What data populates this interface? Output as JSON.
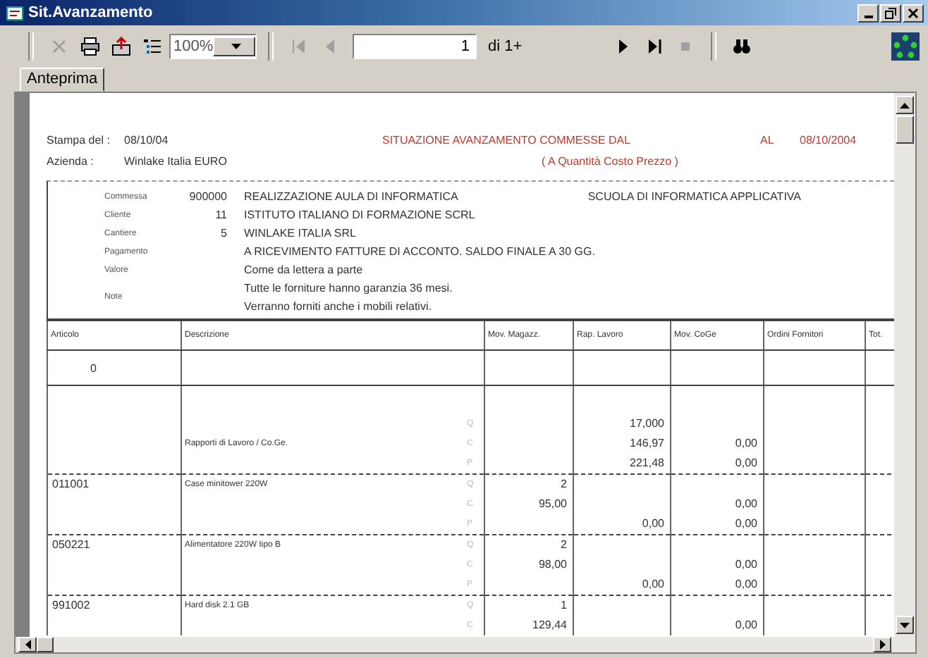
{
  "window": {
    "title": "Sit.Avanzamento"
  },
  "toolbar": {
    "buttons": [
      {
        "kind": "close",
        "disabled": true
      },
      {
        "kind": "print",
        "disabled": false
      },
      {
        "kind": "export",
        "disabled": false
      },
      {
        "kind": "tree",
        "disabled": false
      }
    ],
    "zoom": "100%",
    "nav": [
      {
        "kind": "first",
        "disabled": true
      },
      {
        "kind": "prev",
        "disabled": true
      }
    ],
    "page": "1",
    "page_count": "di 1+",
    "nav2": [
      {
        "kind": "next",
        "disabled": false
      },
      {
        "kind": "last",
        "disabled": false
      },
      {
        "kind": "stop",
        "disabled": true
      },
      {
        "kind": "find",
        "disabled": false
      }
    ]
  },
  "tabs": [
    {
      "label": "Anteprima",
      "selected": true
    }
  ],
  "report": {
    "print_date_label": "Stampa del :",
    "print_date": "08/10/04",
    "company_label": "Azienda :",
    "company": "Winlake Italia EURO",
    "title": "SITUAZIONE AVANZAMENTO COMMESSE  DAL",
    "to_label": "AL",
    "to_date": "08/10/2004",
    "subtitle": "( A Quantità Costo Prezzo  )",
    "fields": [
      {
        "label": "Commessa",
        "code": "900000",
        "lines": [
          "REALIZZAZIONE AULA DI INFORMATICA"
        ],
        "extra": "SCUOLA DI INFORMATICA APPLICATIVA"
      },
      {
        "label": "Cliente",
        "code": "11",
        "lines": [
          "ISTITUTO ITALIANO DI FORMAZIONE SCRL"
        ]
      },
      {
        "label": "Cantiere",
        "code": "5",
        "lines": [
          "WINLAKE ITALIA SRL"
        ]
      },
      {
        "label": "Pagamento",
        "lines": [
          "A RICEVIMENTO FATTURE DI ACCONTO. SALDO FINALE A 30 GG."
        ]
      },
      {
        "label": "Valore",
        "lines": [
          "Come da lettera a parte"
        ]
      },
      {
        "label": "Note",
        "lines": [
          "Tutte le forniture hanno garanzia 36 mesi.",
          "Verranno forniti anche i mobili relativi."
        ]
      }
    ],
    "columns": [
      "Articolo",
      "Descrizione",
      "Mov. Magazz.",
      "Rap. Lavoro",
      "Mov. CoGe",
      "Ordini Fornitori",
      "Tot."
    ],
    "rows": [
      {
        "kind": "group",
        "articolo": "0"
      },
      {
        "kind": "item",
        "descrizione": "Rapporti di Lavoro / Co.Ge.",
        "lines": [
          {
            "label": "Q",
            "rap_lavoro": "17,000"
          },
          {
            "label": "C",
            "rap_lavoro": "146,97",
            "mov_coge": "0,00"
          },
          {
            "label": "P",
            "rap_lavoro": "221,48",
            "mov_coge": "0,00"
          }
        ]
      },
      {
        "kind": "item",
        "articolo": "011001",
        "descrizione": "Case minitower 220W",
        "lines": [
          {
            "label": "Q",
            "mov_magazz": "2"
          },
          {
            "label": "C",
            "mov_magazz": "95,00",
            "mov_coge": "0,00"
          },
          {
            "label": "P",
            "rap_lavoro": "0,00",
            "mov_coge": "0,00"
          }
        ]
      },
      {
        "kind": "item",
        "articolo": "050221",
        "descrizione": "Alimentatore 220W tipo B",
        "lines": [
          {
            "label": "Q",
            "mov_magazz": "2"
          },
          {
            "label": "C",
            "mov_magazz": "98,00",
            "mov_coge": "0,00"
          },
          {
            "label": "P",
            "rap_lavoro": "0,00",
            "mov_coge": "0,00"
          }
        ]
      },
      {
        "kind": "item",
        "articolo": "991002",
        "descrizione": "Hard disk 2.1 GB",
        "lines": [
          {
            "label": "Q",
            "mov_magazz": "1"
          },
          {
            "label": "C",
            "mov_magazz": "129,44",
            "mov_coge": "0,00"
          }
        ]
      }
    ]
  }
}
